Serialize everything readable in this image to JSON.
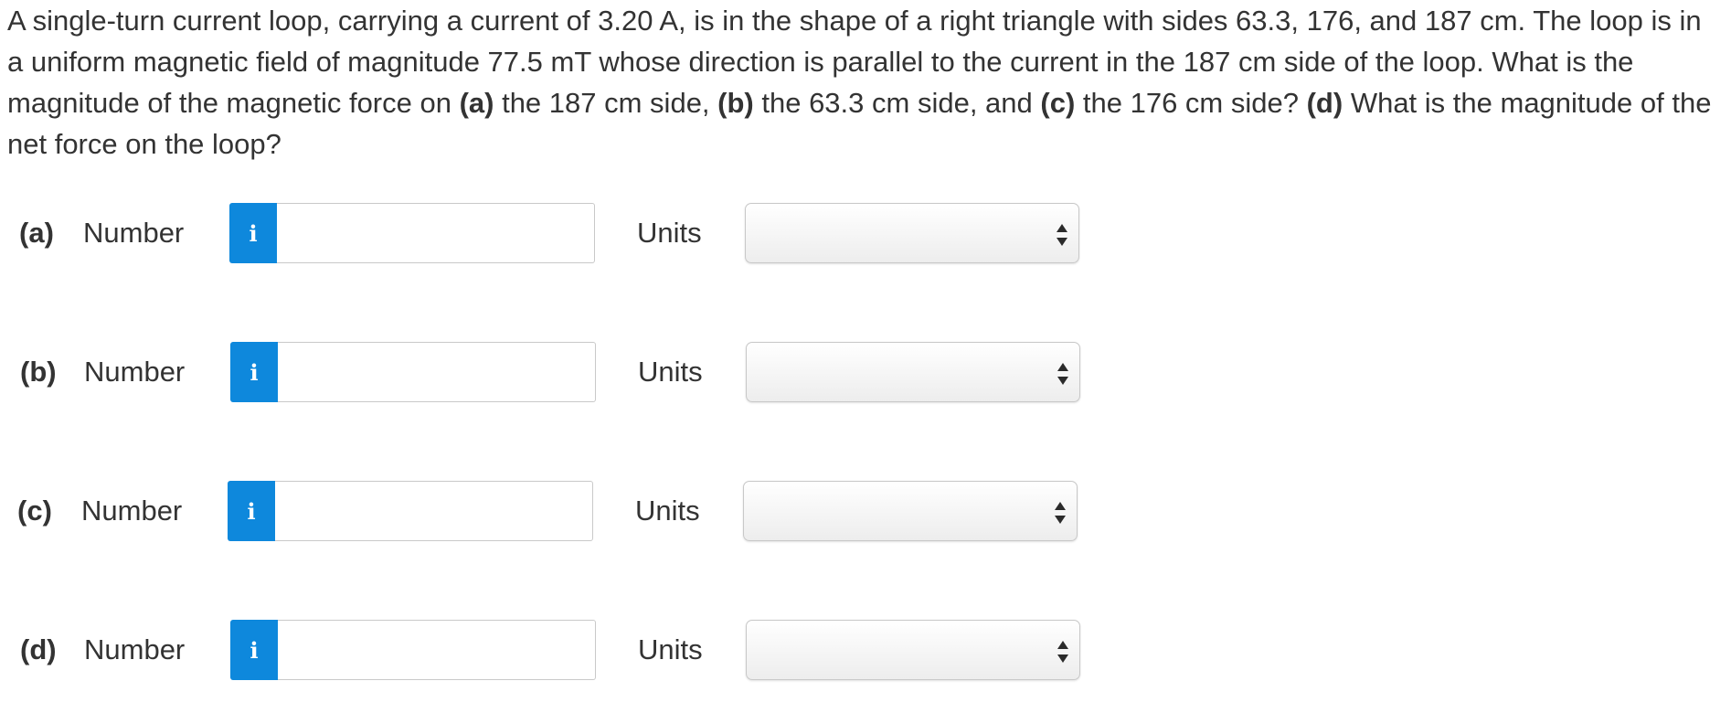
{
  "question": {
    "seg1": "A single-turn current loop, carrying a current of 3.20 A, is in the shape of a right triangle with sides 63.3, 176, and 187 cm. The loop is in a uniform magnetic field of magnitude 77.5 mT whose direction is parallel to the current in the 187 cm side of the loop. What is the magnitude of the magnetic force on ",
    "a_marker": "(a)",
    "seg2": " the 187 cm side, ",
    "b_marker": "(b)",
    "seg3": " the 63.3 cm side, and ",
    "c_marker": "(c)",
    "seg4": " the 176 cm side? ",
    "d_marker": "(d)",
    "seg5": " What is the magnitude of the net force on the loop?"
  },
  "rows": [
    {
      "part": "(a)",
      "number_label": "Number",
      "info_glyph": "i",
      "value": "",
      "units_label": "Units",
      "units_value": ""
    },
    {
      "part": "(b)",
      "number_label": "Number",
      "info_glyph": "i",
      "value": "",
      "units_label": "Units",
      "units_value": ""
    },
    {
      "part": "(c)",
      "number_label": "Number",
      "info_glyph": "i",
      "value": "",
      "units_label": "Units",
      "units_value": ""
    },
    {
      "part": "(d)",
      "number_label": "Number",
      "info_glyph": "i",
      "value": "",
      "units_label": "Units",
      "units_value": ""
    }
  ],
  "colors": {
    "info_button": "#0e88dc",
    "text": "#333333"
  },
  "icons": {
    "info": "info-icon",
    "select": "up-down-arrows-icon"
  }
}
